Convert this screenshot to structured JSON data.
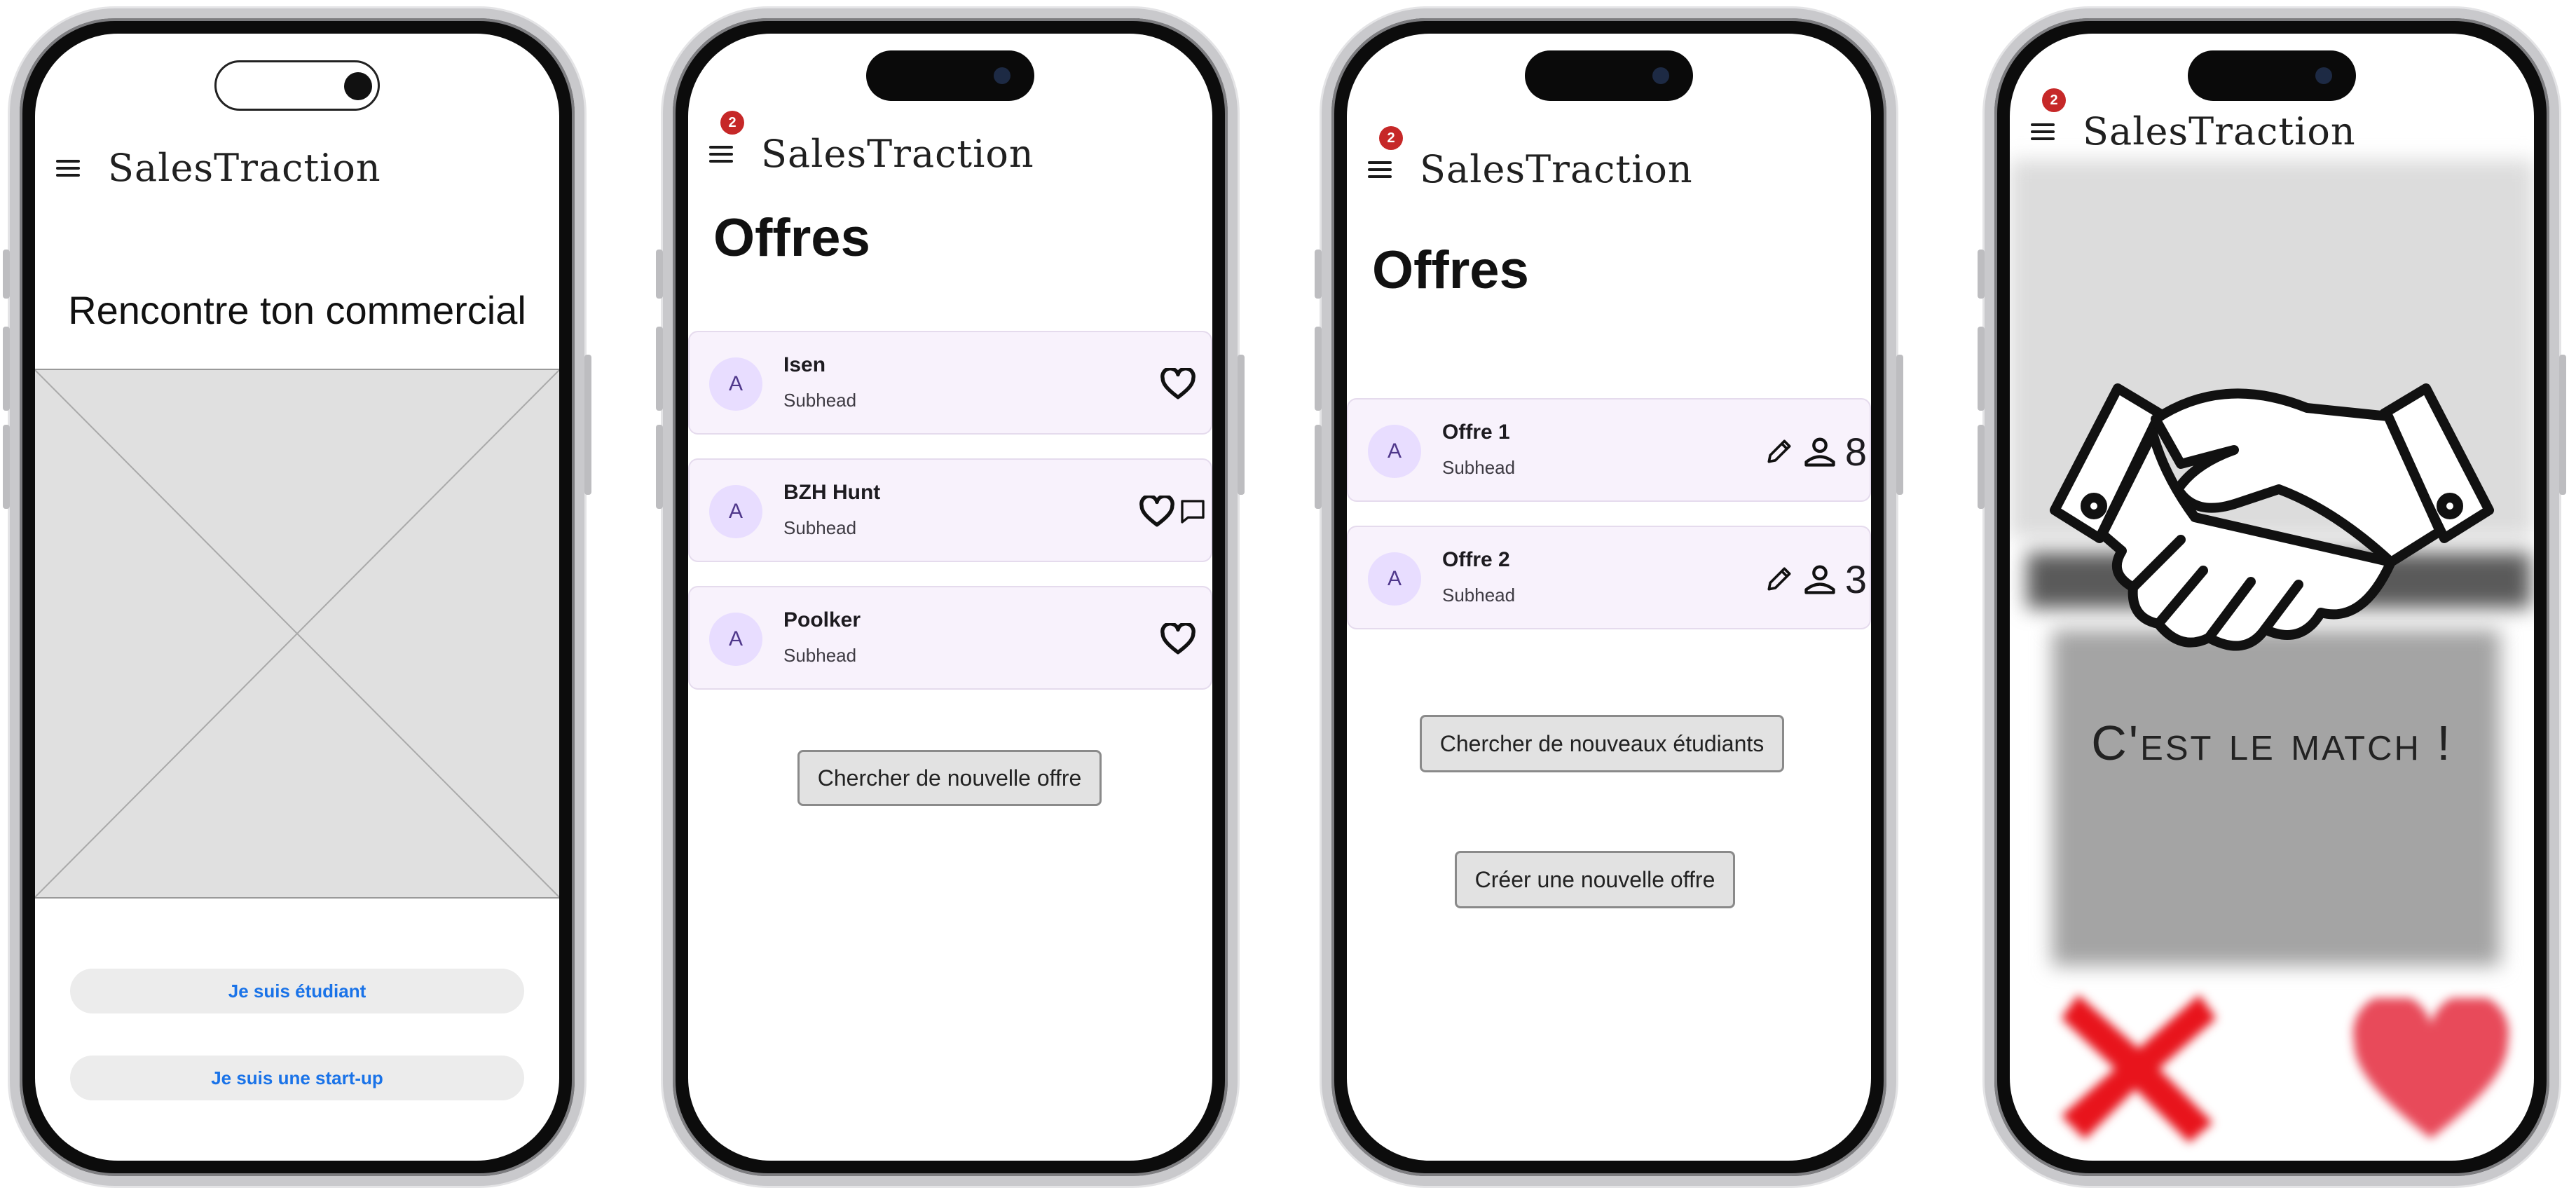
{
  "app": {
    "logo": "SalesTraction",
    "notification_count": "2"
  },
  "screen1": {
    "headline": "Rencontre ton commercial",
    "buttons": {
      "student": "Je suis étudiant",
      "startup": "Je suis une start-up"
    }
  },
  "screen2": {
    "title": "Offres",
    "offers": [
      {
        "avatar": "A",
        "name": "Isen",
        "subhead": "Subhead"
      },
      {
        "avatar": "A",
        "name": "BZH Hunt",
        "subhead": "Subhead"
      },
      {
        "avatar": "A",
        "name": "Poolker",
        "subhead": "Subhead"
      }
    ],
    "search_button": "Chercher de nouvelle offre"
  },
  "screen3": {
    "title": "Offres",
    "offers": [
      {
        "avatar": "A",
        "name": "Offre 1",
        "subhead": "Subhead",
        "count": "8"
      },
      {
        "avatar": "A",
        "name": "Offre 2",
        "subhead": "Subhead",
        "count": "3"
      }
    ],
    "search_button": "Chercher de nouveaux étudiants",
    "create_button": "Créer une nouvelle offre"
  },
  "screen4": {
    "match_text": "C'est le match !"
  },
  "icons": {
    "menu": "menu-icon",
    "heart": "heart-icon",
    "comment": "comment-icon",
    "edit": "pencil-icon",
    "person": "person-icon",
    "handshake": "handshake-icon",
    "reject": "cross-icon",
    "like": "heart-icon"
  },
  "colors": {
    "badge": "#c62828",
    "card_bg": "#f8f2fc",
    "avatar_bg": "#e8ddff",
    "link_blue": "#1a73e8",
    "reject_red": "#e8141c",
    "like_red": "#e84a5a"
  }
}
